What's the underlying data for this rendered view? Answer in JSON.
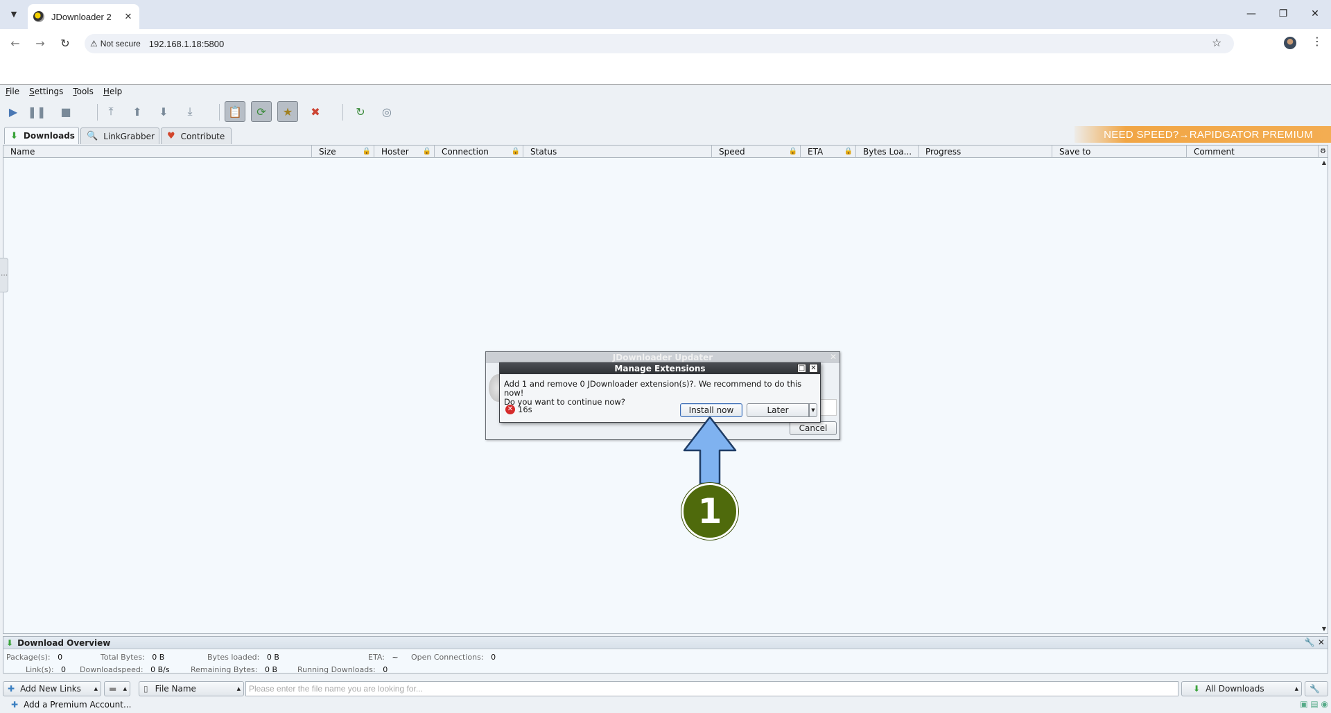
{
  "browser": {
    "tab_title": "JDownloader 2",
    "not_secure": "Not secure",
    "url": "192.168.1.18:5800"
  },
  "menu": [
    "File",
    "Settings",
    "Tools",
    "Help"
  ],
  "tabs": {
    "downloads": "Downloads",
    "linkgrabber": "LinkGrabber",
    "contribute": "Contribute"
  },
  "promo": "NEED SPEED?→RAPIDGATOR PREMIUM",
  "columns": [
    "Name",
    "Size",
    "Hoster",
    "Connection",
    "Status",
    "Speed",
    "ETA",
    "Bytes Loa...",
    "Progress",
    "Save to",
    "Comment"
  ],
  "overview": {
    "title": "Download Overview",
    "packages_label": "Package(s):",
    "packages": "0",
    "total_bytes_label": "Total Bytes:",
    "total_bytes": "0 B",
    "bytes_loaded_label": "Bytes loaded:",
    "bytes_loaded": "0 B",
    "eta_label": "ETA:",
    "eta": "~",
    "open_conn_label": "Open Connections:",
    "open_conn": "0",
    "links_label": "Link(s):",
    "links": "0",
    "dlspeed_label": "Downloadspeed:",
    "dlspeed": "0 B/s",
    "remaining_label": "Remaining Bytes:",
    "remaining": "0 B",
    "running_label": "Running Downloads:",
    "running": "0"
  },
  "bottombar": {
    "add_links": "Add New Links",
    "file_name": "File Name",
    "search_placeholder": "Please enter the file name you are looking for...",
    "all_downloads": "All Downloads"
  },
  "status": {
    "premium": "Add a Premium Account..."
  },
  "updater": {
    "title": "JDownloader Updater",
    "cancel": "Cancel"
  },
  "dialog": {
    "title": "Manage Extensions",
    "line1": "Add 1 and remove 0 JDownloader extension(s)?. We recommend to do this now!",
    "line2": "Do you want to continue now?",
    "countdown": "16s",
    "install": "Install now",
    "later": "Later"
  },
  "annotation": {
    "step": "1"
  },
  "colors": {
    "annotation_arrow": "#7fb2f0",
    "annotation_badge": "#4f6a0c",
    "promo": "#f1a645"
  }
}
